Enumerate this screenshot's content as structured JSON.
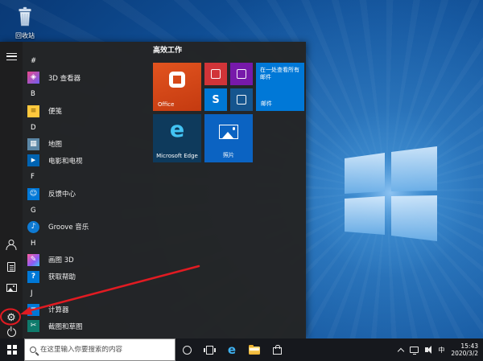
{
  "desktop": {
    "recycle_bin_label": "回收站"
  },
  "icons": {
    "settings_gear": "⚙"
  },
  "start_menu": {
    "app_list": [
      {
        "kind": "header",
        "label": "#"
      },
      {
        "kind": "app",
        "label": "3D 查看器",
        "icon": "3d-viewer-icon",
        "glyph": "◈"
      },
      {
        "kind": "header",
        "label": "B"
      },
      {
        "kind": "app",
        "label": "便笺",
        "icon": "sticky-notes-icon",
        "glyph": "≡"
      },
      {
        "kind": "header",
        "label": "D"
      },
      {
        "kind": "app",
        "label": "地图",
        "icon": "maps-icon",
        "glyph": "▦"
      },
      {
        "kind": "app",
        "label": "电影和电视",
        "icon": "movies-tv-icon",
        "glyph": "▶"
      },
      {
        "kind": "header",
        "label": "F"
      },
      {
        "kind": "app",
        "label": "反馈中心",
        "icon": "feedback-hub-icon",
        "glyph": "☺"
      },
      {
        "kind": "header",
        "label": "G"
      },
      {
        "kind": "app",
        "label": "Groove 音乐",
        "icon": "groove-music-icon",
        "glyph": "♪"
      },
      {
        "kind": "header",
        "label": "H"
      },
      {
        "kind": "app",
        "label": "画图 3D",
        "icon": "paint-3d-icon",
        "glyph": "✎"
      },
      {
        "kind": "app",
        "label": "获取帮助",
        "icon": "get-help-icon",
        "glyph": "?"
      },
      {
        "kind": "header",
        "label": "J"
      },
      {
        "kind": "app",
        "label": "计算器",
        "icon": "calculator-icon",
        "glyph": "="
      },
      {
        "kind": "app",
        "label": "截图和草图",
        "icon": "snip-sketch-icon",
        "glyph": "✂"
      }
    ],
    "tiles": {
      "group_label": "高效工作",
      "office": {
        "label": "Office"
      },
      "mail": {
        "live_text": "在一处查看所有邮件",
        "label": "邮件"
      },
      "edge": {
        "label": "Microsoft Edge",
        "letter": "e"
      },
      "photos": {
        "label": "照片"
      },
      "skype": {
        "letter": "S"
      }
    }
  },
  "taskbar": {
    "search": {
      "placeholder": "在这里输入你要搜索的内容"
    },
    "edge_letter": "e",
    "tray": {
      "ime": "中",
      "time": "15:43",
      "date": "2020/3/2"
    }
  },
  "colors": {
    "accent": "#0078d7",
    "annotation_red": "#e11b22",
    "start_menu_bg": "#242424",
    "taskbar_bg": "#16181d",
    "tile_office": "#d83b01",
    "tile_mail": "#0078d7",
    "tile_edge_bg": "#0e3a5c",
    "tile_photos": "#0b63c2"
  }
}
